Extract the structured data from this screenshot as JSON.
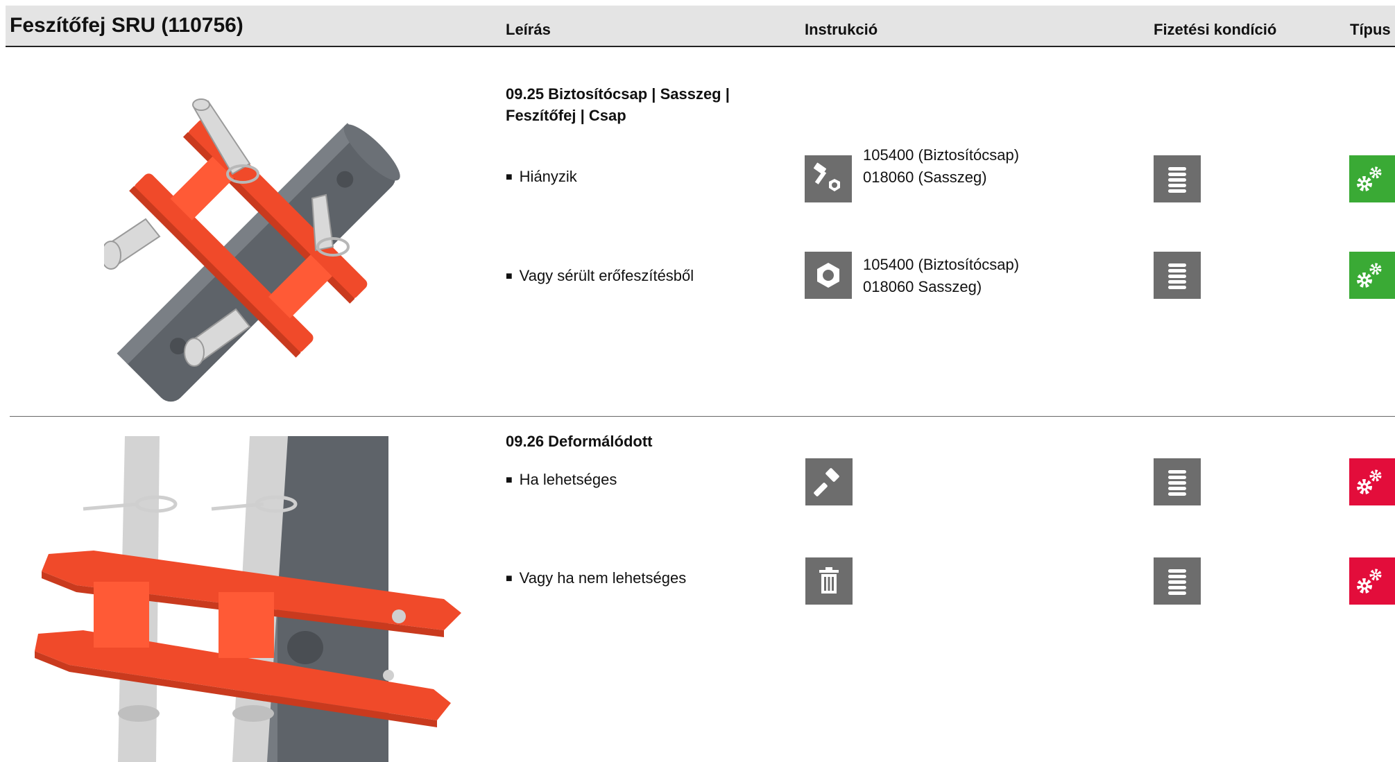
{
  "header": {
    "title": "Feszítőfej SRU (110756)",
    "columns": {
      "leiras": "Leírás",
      "instrukcio": "Instrukció",
      "fizetesi_kondicio": "Fizetési kondíció",
      "tipus": "Típus"
    }
  },
  "sections": [
    {
      "title": "09.25 Biztosítócsap | Sasszeg | Feszítőfej | Csap",
      "image_icon": "bracket-pins-top-view",
      "rows": [
        {
          "text": "Hiányzik",
          "instruction_icon": "bolt-nut-icon",
          "parts": [
            "105400 (Biztosítócsap)",
            "018060 (Sasszeg)"
          ],
          "payment_icon": "coin-stack-icon",
          "type_icon": "gears-icon",
          "type_color": "#3aaa35"
        },
        {
          "text": "Vagy sérült erőfeszítésből",
          "instruction_icon": "nut-icon",
          "parts": [
            "105400 (Biztosítócsap)",
            "018060 Sasszeg)"
          ],
          "payment_icon": "coin-stack-icon",
          "type_icon": "gears-icon",
          "type_color": "#3aaa35"
        }
      ]
    },
    {
      "title": "09.26 Deformálódott",
      "image_icon": "bracket-pins-side-view",
      "rows": [
        {
          "text": "Ha lehetséges",
          "instruction_icon": "hammer-icon",
          "parts": [],
          "payment_icon": "coin-stack-icon",
          "type_icon": "gears-icon",
          "type_color": "#e30d3b"
        },
        {
          "text": "Vagy ha nem lehetséges",
          "instruction_icon": "trash-icon",
          "parts": [],
          "payment_icon": "coin-stack-icon",
          "type_icon": "gears-icon",
          "type_color": "#e30d3b"
        }
      ]
    }
  ],
  "colors": {
    "header_bg": "#e4e4e4",
    "tile_gray": "#6d6d6d",
    "part_orange": "#f04a2a",
    "tube_gray": "#5e6369"
  }
}
